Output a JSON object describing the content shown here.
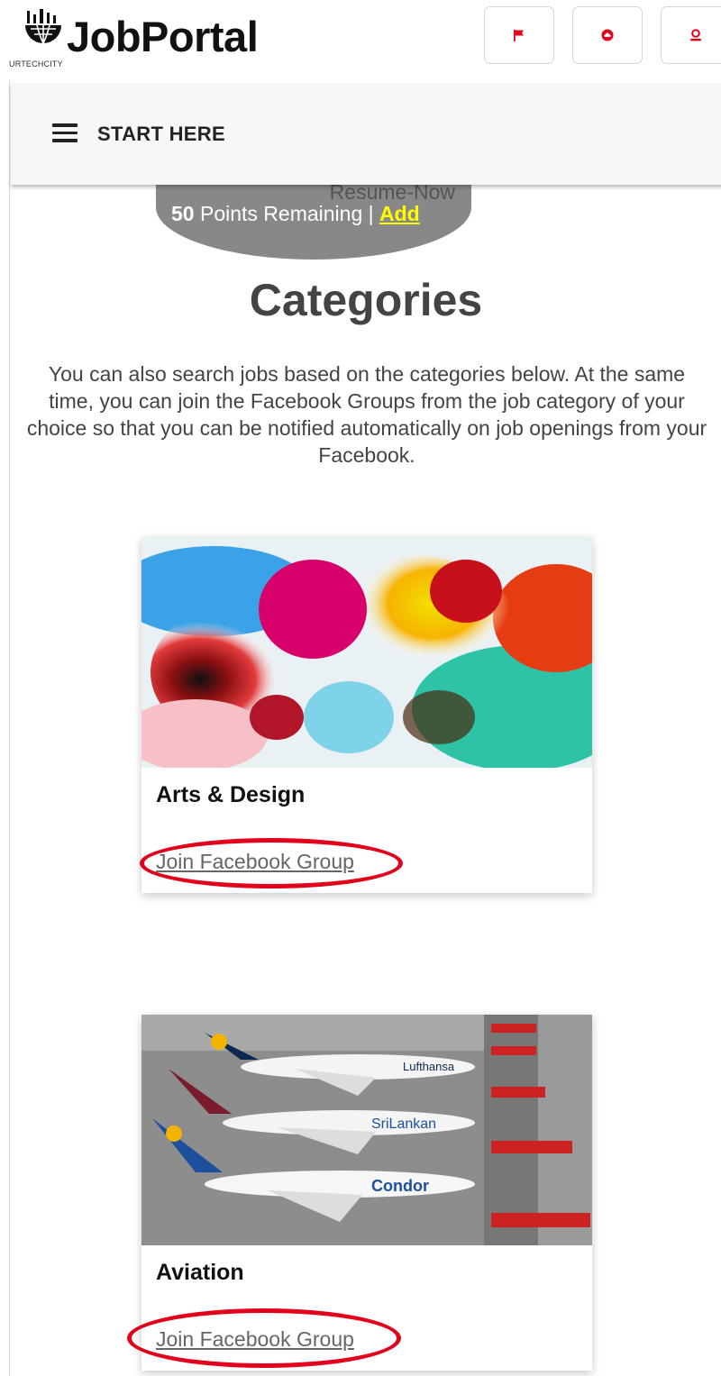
{
  "header": {
    "brand": "JobPortal",
    "tagline": "URTECHCITY",
    "icons": [
      "flag-icon",
      "inbox-icon",
      "user-icon"
    ],
    "icon_color": "#e2001a"
  },
  "nav": {
    "menu_label": "START HERE"
  },
  "points": {
    "service": "Resume-Now",
    "count": "50",
    "text": "Points Remaining |",
    "add_label": "Add"
  },
  "page": {
    "title": "Categories",
    "description": "You can also search jobs based on the categories below. At the same time, you can join the Facebook Groups from the job category of your choice so that you can be notified automatically on job openings from your Facebook."
  },
  "categories": [
    {
      "name": "Arts & Design",
      "link_label": "Join Facebook Group",
      "image": "abstract-paint-image"
    },
    {
      "name": "Aviation",
      "link_label": "Join Facebook Group",
      "image": "airport-planes-image"
    }
  ],
  "colors": {
    "accent": "#e2001a",
    "points_bg": "#888888",
    "add_link": "#ffff00"
  }
}
